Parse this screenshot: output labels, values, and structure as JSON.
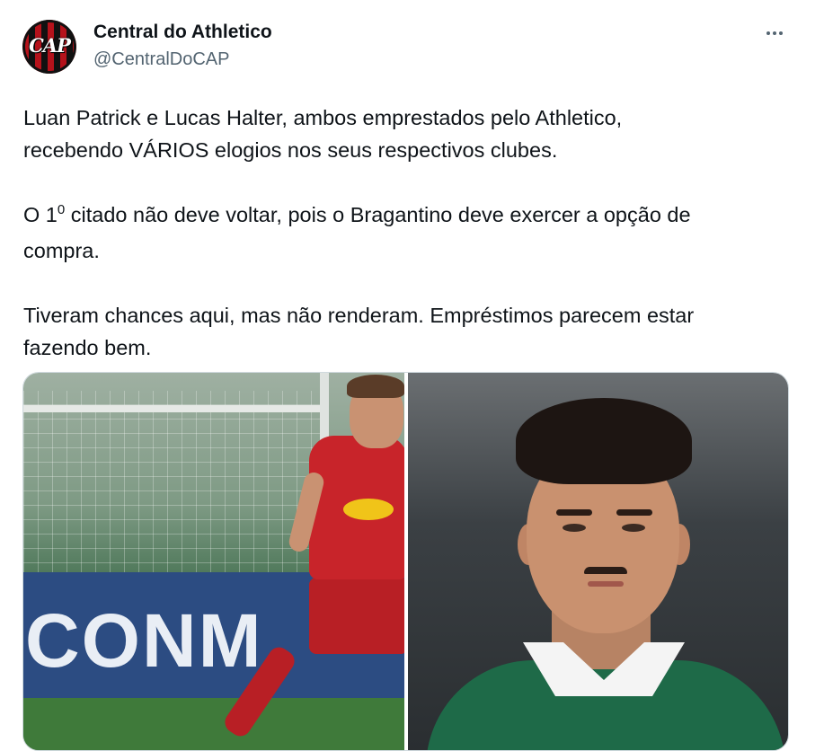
{
  "account": {
    "display_name": "Central do Athletico",
    "handle": "@CentralDoCAP",
    "avatar_text": "CAP"
  },
  "tweet": {
    "line1": "Luan Patrick e Lucas Halter, ambos emprestados pelo Athletico,",
    "line2": "recebendo VÁRIOS elogios nos seus respectivos clubes.",
    "line3_before": "O 1",
    "line3_sup": "0",
    "line3_after": " citado não deve voltar, pois o Bragantino deve exercer a opção de",
    "line4": "compra.",
    "line5": "Tiveram chances aqui, mas não renderam. Empréstimos parecem estar",
    "line6": "fazendo bem."
  },
  "media": {
    "left_board_text": "CONM"
  },
  "icons": {
    "more": "more-horizontal-icon"
  },
  "colors": {
    "text_primary": "#0f1419",
    "text_secondary": "#536471",
    "border": "#cfd9de"
  }
}
